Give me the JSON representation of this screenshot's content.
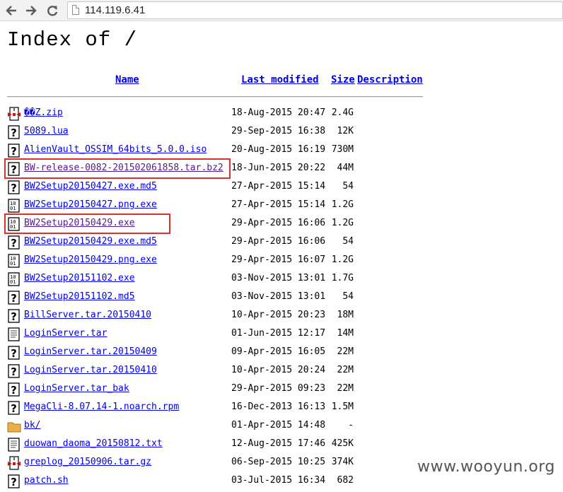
{
  "browser": {
    "back_icon": "arrow-left-icon",
    "forward_icon": "arrow-right-icon",
    "reload_icon": "reload-icon",
    "url": "114.119.6.41"
  },
  "page": {
    "title": "Index of /",
    "columns": {
      "name": "Name",
      "last_modified": "Last modified",
      "size": "Size",
      "description": "Description"
    },
    "files": [
      {
        "name": "��Z.zip",
        "date": "18-Aug-2015 20:47",
        "size": "2.4G",
        "icon": "archive-icon",
        "highlighted": false
      },
      {
        "name": "5089.lua",
        "date": "29-Sep-2015 16:38",
        "size": "12K",
        "icon": "unknown-file-icon",
        "highlighted": false
      },
      {
        "name": "AlienVault_OSSIM_64bits_5.0.0.iso",
        "date": "20-Aug-2015 16:19",
        "size": "730M",
        "icon": "unknown-file-icon",
        "highlighted": false
      },
      {
        "name": "BW-release-0082-201502061858.tar.bz2",
        "date": "18-Jun-2015 20:22",
        "size": "44M",
        "icon": "unknown-file-icon",
        "highlighted": true
      },
      {
        "name": "BW2Setup20150427.exe.md5",
        "date": "27-Apr-2015 15:14",
        "size": "54",
        "icon": "unknown-file-icon",
        "highlighted": false
      },
      {
        "name": "BW2Setup20150427.png.exe",
        "date": "27-Apr-2015 15:14",
        "size": "1.2G",
        "icon": "binary-file-icon",
        "highlighted": false
      },
      {
        "name": "BW2Setup20150429.exe",
        "date": "29-Apr-2015 16:06",
        "size": "1.2G",
        "icon": "binary-file-icon",
        "highlighted": true
      },
      {
        "name": "BW2Setup20150429.exe.md5",
        "date": "29-Apr-2015 16:06",
        "size": "54",
        "icon": "unknown-file-icon",
        "highlighted": false
      },
      {
        "name": "BW2Setup20150429.png.exe",
        "date": "29-Apr-2015 16:07",
        "size": "1.2G",
        "icon": "binary-file-icon",
        "highlighted": false
      },
      {
        "name": "BW2Setup20151102.exe",
        "date": "03-Nov-2015 13:01",
        "size": "1.7G",
        "icon": "binary-file-icon",
        "highlighted": false
      },
      {
        "name": "BW2Setup20151102.md5",
        "date": "03-Nov-2015 13:01",
        "size": "54",
        "icon": "unknown-file-icon",
        "highlighted": false
      },
      {
        "name": "BillServer.tar.20150410",
        "date": "10-Apr-2015 20:23",
        "size": "18M",
        "icon": "unknown-file-icon",
        "highlighted": false
      },
      {
        "name": "LoginServer.tar",
        "date": "01-Jun-2015 12:17",
        "size": "14M",
        "icon": "text-file-icon",
        "highlighted": false
      },
      {
        "name": "LoginServer.tar.20150409",
        "date": "09-Apr-2015 16:05",
        "size": "22M",
        "icon": "unknown-file-icon",
        "highlighted": false
      },
      {
        "name": "LoginServer.tar.20150410",
        "date": "10-Apr-2015 20:24",
        "size": "22M",
        "icon": "unknown-file-icon",
        "highlighted": false
      },
      {
        "name": "LoginServer.tar_bak",
        "date": "29-Apr-2015 09:23",
        "size": "22M",
        "icon": "unknown-file-icon",
        "highlighted": false
      },
      {
        "name": "MegaCli-8.07.14-1.noarch.rpm",
        "date": "16-Dec-2013 16:13",
        "size": "1.5M",
        "icon": "unknown-file-icon",
        "highlighted": false
      },
      {
        "name": "bk/",
        "date": "01-Apr-2015 14:48",
        "size": "-",
        "icon": "folder-icon",
        "highlighted": false
      },
      {
        "name": "duowan_daoma_20150812.txt",
        "date": "12-Aug-2015 17:46",
        "size": "425K",
        "icon": "text-file-icon",
        "highlighted": false
      },
      {
        "name": "greplog_20150906.tar.gz",
        "date": "06-Sep-2015 10:25",
        "size": "374K",
        "icon": "archive-icon",
        "highlighted": false
      },
      {
        "name": "patch.sh",
        "date": "03-Jul-2015 16:34",
        "size": "682",
        "icon": "unknown-file-icon",
        "highlighted": false
      }
    ]
  },
  "watermark": "www.wooyun.org",
  "colors": {
    "link": "#0000ee",
    "visited": "#551a8b",
    "highlight": "#d9302c"
  }
}
